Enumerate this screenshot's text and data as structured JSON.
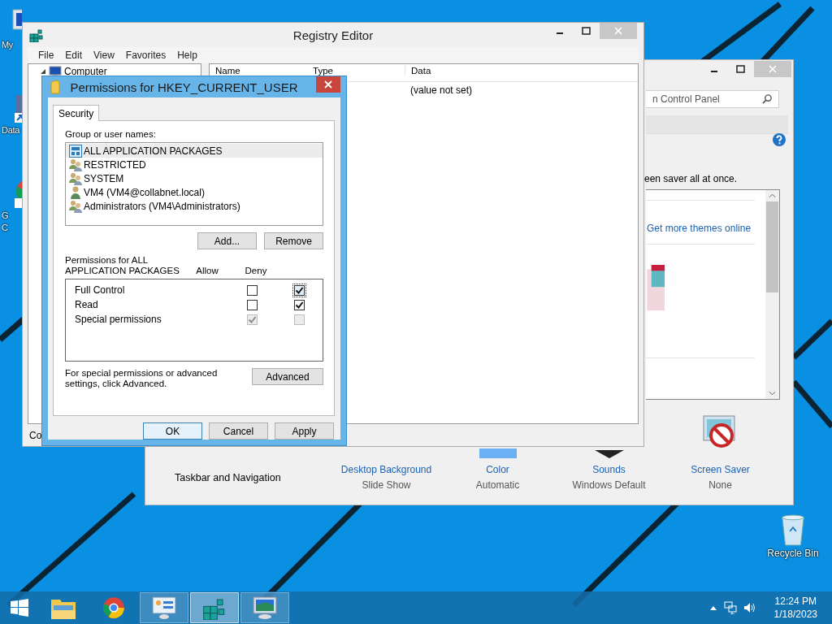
{
  "desktop": {
    "icons": [
      {
        "kind": "computer",
        "lines": [
          "My"
        ]
      },
      {
        "kind": "shortcut",
        "lines": [
          "Data"
        ]
      },
      {
        "kind": "browser",
        "lines": [
          "G",
          "C"
        ]
      }
    ],
    "recycle_bin": {
      "label": "Recycle Bin"
    }
  },
  "control_panel": {
    "search": {
      "placeholder": "n Control Panel"
    },
    "description": "een saver all at once.",
    "themes_link": "Get more themes online",
    "taskbar_link": "Taskbar and Navigation",
    "settings": [
      {
        "kind": "background",
        "label": "Desktop Background",
        "value": "Slide Show"
      },
      {
        "kind": "color",
        "label": "Color",
        "value": "Automatic"
      },
      {
        "kind": "sounds",
        "label": "Sounds",
        "value": "Windows Default"
      },
      {
        "kind": "screensaver",
        "label": "Screen Saver",
        "value": "None"
      }
    ]
  },
  "registry_editor": {
    "title": "Registry Editor",
    "menu": [
      "File",
      "Edit",
      "View",
      "Favorites",
      "Help"
    ],
    "tree": [
      {
        "label": "Computer",
        "expanded": true
      }
    ],
    "columns": [
      "Name",
      "Type",
      "Data"
    ],
    "rows": [
      {
        "data": "(value not set)"
      }
    ],
    "status": "Co"
  },
  "permissions_dialog": {
    "title": "Permissions for HKEY_CURRENT_USER",
    "tabs": [
      {
        "label": "Security",
        "selected": true
      }
    ],
    "group_label": "Group or user names:",
    "users": [
      {
        "name": "ALL APPLICATION PACKAGES",
        "kind": "package",
        "selected": true
      },
      {
        "name": "RESTRICTED",
        "kind": "group",
        "selected": false
      },
      {
        "name": "SYSTEM",
        "kind": "group",
        "selected": false
      },
      {
        "name": "VM4 (VM4@collabnet.local)",
        "kind": "user",
        "selected": false
      },
      {
        "name": "Administrators (VM4\\Administrators)",
        "kind": "group",
        "selected": false
      }
    ],
    "user_buttons": [
      "Add...",
      "Remove"
    ],
    "permissions_label": "Permissions for ALL APPLICATION PACKAGES",
    "allow_label": "Allow",
    "deny_label": "Deny",
    "permissions": [
      {
        "name": "Full Control",
        "allow": {
          "checked": false,
          "disabled": false,
          "focused": false
        },
        "deny": {
          "checked": true,
          "disabled": false,
          "focused": true
        }
      },
      {
        "name": "Read",
        "allow": {
          "checked": false,
          "disabled": false,
          "focused": false
        },
        "deny": {
          "checked": true,
          "disabled": false,
          "focused": false
        }
      },
      {
        "name": "Special permissions",
        "allow": {
          "checked": true,
          "disabled": true,
          "focused": false
        },
        "deny": {
          "checked": false,
          "disabled": true,
          "focused": false
        }
      }
    ],
    "advanced_note": "For special permissions or advanced settings, click Advanced.",
    "advanced_button": "Advanced",
    "buttons": [
      {
        "label": "OK",
        "default": true
      },
      {
        "label": "Cancel",
        "default": false
      },
      {
        "label": "Apply",
        "default": false
      }
    ]
  },
  "taskbar": {
    "apps": [
      {
        "kind": "explorer",
        "running": false,
        "selected": false
      },
      {
        "kind": "browser",
        "running": false,
        "selected": false
      },
      {
        "kind": "control-panel",
        "running": true,
        "selected": false
      },
      {
        "kind": "registry",
        "running": true,
        "selected": true
      },
      {
        "kind": "display",
        "running": true,
        "selected": false
      }
    ],
    "time": "12:24 PM",
    "date": "1/18/2023"
  }
}
